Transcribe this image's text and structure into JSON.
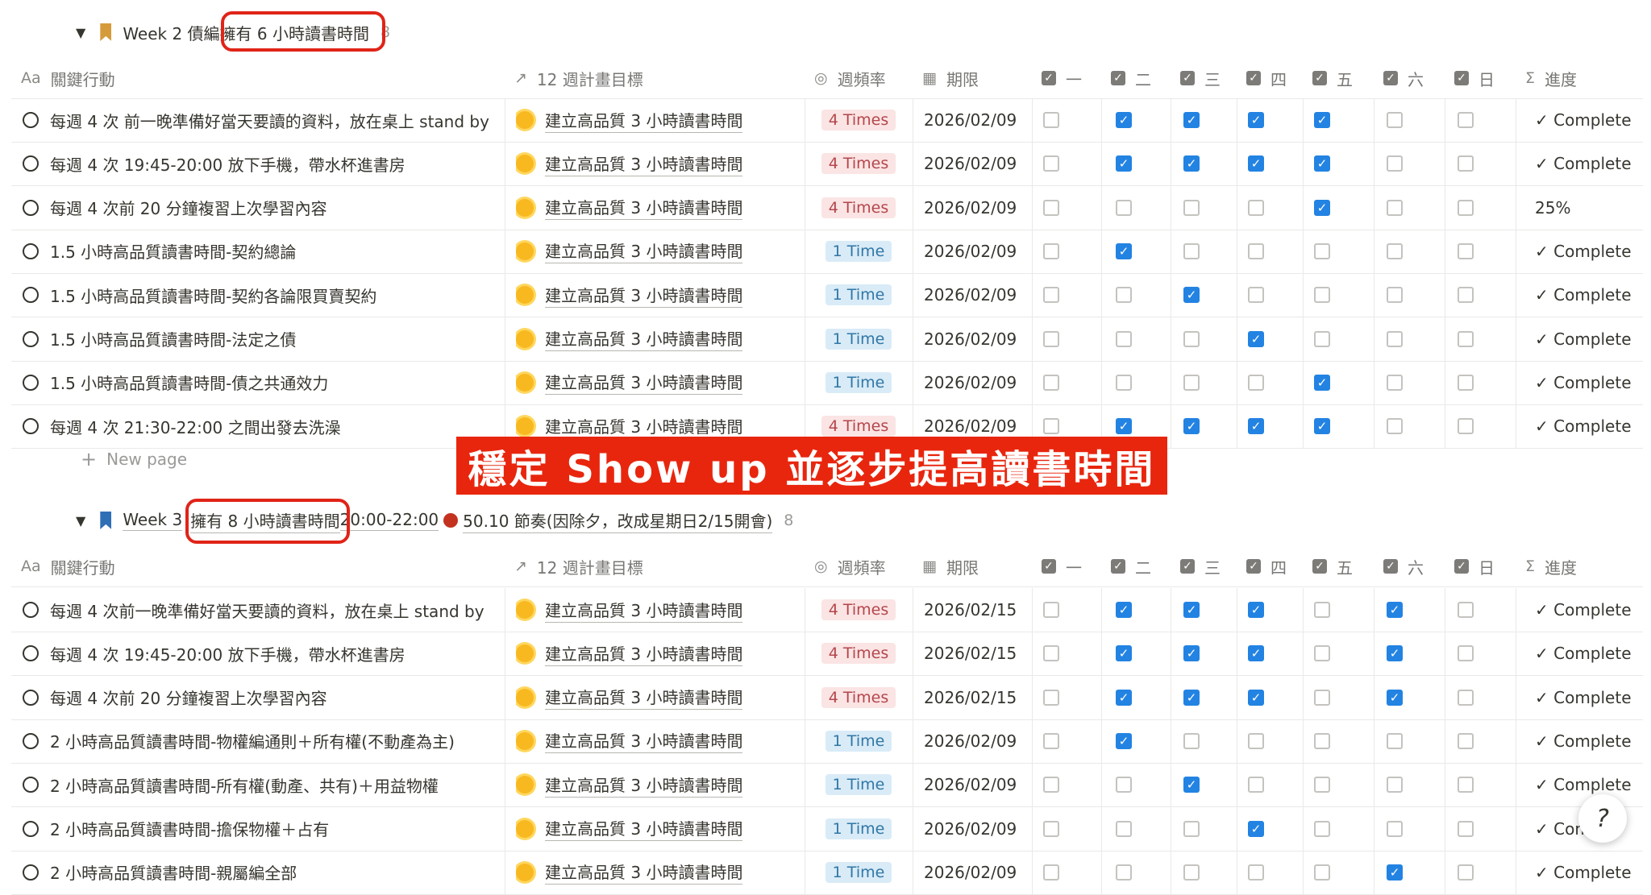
{
  "columns": [
    {
      "key": "name",
      "icon": "Aa",
      "label": "關鍵行動"
    },
    {
      "key": "goal",
      "icon": "↗",
      "label": "12 週計畫目標"
    },
    {
      "key": "freq",
      "icon": "◎",
      "label": "週頻率"
    },
    {
      "key": "date",
      "icon": "calendar-icon",
      "label": "期限"
    },
    {
      "key": "mon",
      "icon": "checkbox-icon",
      "label": "一"
    },
    {
      "key": "tue",
      "icon": "checkbox-icon",
      "label": "二"
    },
    {
      "key": "wed",
      "icon": "checkbox-icon",
      "label": "三"
    },
    {
      "key": "thu",
      "icon": "checkbox-icon",
      "label": "四"
    },
    {
      "key": "fri",
      "icon": "checkbox-icon",
      "label": "五"
    },
    {
      "key": "sat",
      "icon": "checkbox-icon",
      "label": "六"
    },
    {
      "key": "sun",
      "icon": "checkbox-icon",
      "label": "日"
    },
    {
      "key": "prog",
      "icon": "Σ",
      "label": "進度"
    }
  ],
  "groups": [
    {
      "title_prefix": "Week 2 債編",
      "title_highlight": "擁有 6 小時讀書時間",
      "title_suffix": "",
      "count": "8",
      "bookmark_color": "#d59b3a",
      "rows": [
        {
          "name": "每週 4 次 前一晚準備好當天要讀的資料，放在桌上 stand by",
          "goal": "建立高品質 3 小時讀書時間",
          "freq": "4 Times",
          "freq_color": "red",
          "date": "2026/02/09",
          "days": [
            false,
            true,
            true,
            true,
            true,
            false,
            false
          ],
          "progress": "✓ Complete"
        },
        {
          "name": "每週 4 次 19:45-20:00 放下手機，帶水杯進書房",
          "goal": "建立高品質 3 小時讀書時間",
          "freq": "4 Times",
          "freq_color": "red",
          "date": "2026/02/09",
          "days": [
            false,
            true,
            true,
            true,
            true,
            false,
            false
          ],
          "progress": "✓ Complete"
        },
        {
          "name": "每週 4 次前 20 分鐘複習上次學習內容",
          "goal": "建立高品質 3 小時讀書時間",
          "freq": "4 Times",
          "freq_color": "red",
          "date": "2026/02/09",
          "days": [
            false,
            false,
            false,
            false,
            true,
            false,
            false
          ],
          "progress": "25%"
        },
        {
          "name": "1.5 小時高品質讀書時間-契約總論",
          "goal": "建立高品質 3 小時讀書時間",
          "freq": "1 Time",
          "freq_color": "blue",
          "date": "2026/02/09",
          "days": [
            false,
            true,
            false,
            false,
            false,
            false,
            false
          ],
          "progress": "✓ Complete"
        },
        {
          "name": "1.5 小時高品質讀書時間-契約各論限買賣契約",
          "goal": "建立高品質 3 小時讀書時間",
          "freq": "1 Time",
          "freq_color": "blue",
          "date": "2026/02/09",
          "days": [
            false,
            false,
            true,
            false,
            false,
            false,
            false
          ],
          "progress": "✓ Complete"
        },
        {
          "name": "1.5 小時高品質讀書時間-法定之債",
          "goal": "建立高品質 3 小時讀書時間",
          "freq": "1 Time",
          "freq_color": "blue",
          "date": "2026/02/09",
          "days": [
            false,
            false,
            false,
            true,
            false,
            false,
            false
          ],
          "progress": "✓ Complete"
        },
        {
          "name": "1.5 小時高品質讀書時間-債之共通效力",
          "goal": "建立高品質 3 小時讀書時間",
          "freq": "1 Time",
          "freq_color": "blue",
          "date": "2026/02/09",
          "days": [
            false,
            false,
            false,
            false,
            true,
            false,
            false
          ],
          "progress": "✓ Complete"
        },
        {
          "name": "每週 4 次 21:30-22:00 之間出發去洗澡",
          "goal": "建立高品質 3 小時讀書時間",
          "freq": "4 Times",
          "freq_color": "red",
          "date": "2026/02/09",
          "days": [
            false,
            true,
            true,
            true,
            true,
            false,
            false
          ],
          "progress": "✓ Complete"
        }
      ]
    },
    {
      "title_prefix": "Week 3",
      "title_highlight": "擁有 8 小時讀書時間",
      "title_suffix": "20:00-22:00",
      "title_tail": "50.10 節奏(因除夕，改成星期日2/15開會)",
      "count": "8",
      "bookmark_color": "#2f6fb5",
      "rows": [
        {
          "name": "每週 4 次前一晚準備好當天要讀的資料，放在桌上 stand by",
          "goal": "建立高品質 3 小時讀書時間",
          "freq": "4 Times",
          "freq_color": "red",
          "date": "2026/02/15",
          "days": [
            false,
            true,
            true,
            true,
            false,
            true,
            false
          ],
          "progress": "✓ Complete"
        },
        {
          "name": "每週 4 次 19:45-20:00 放下手機，帶水杯進書房",
          "goal": "建立高品質 3 小時讀書時間",
          "freq": "4 Times",
          "freq_color": "red",
          "date": "2026/02/15",
          "days": [
            false,
            true,
            true,
            true,
            false,
            true,
            false
          ],
          "progress": "✓ Complete"
        },
        {
          "name": "每週 4 次前 20 分鐘複習上次學習內容",
          "goal": "建立高品質 3 小時讀書時間",
          "freq": "4 Times",
          "freq_color": "red",
          "date": "2026/02/15",
          "days": [
            false,
            true,
            true,
            true,
            false,
            true,
            false
          ],
          "progress": "✓ Complete"
        },
        {
          "name": "2 小時高品質讀書時間-物權編通則＋所有權(不動產為主)",
          "goal": "建立高品質 3 小時讀書時間",
          "freq": "1 Time",
          "freq_color": "blue",
          "date": "2026/02/09",
          "days": [
            false,
            true,
            false,
            false,
            false,
            false,
            false
          ],
          "progress": "✓ Complete"
        },
        {
          "name": "2 小時高品質讀書時間-所有權(動產、共有)＋用益物權",
          "goal": "建立高品質 3 小時讀書時間",
          "freq": "1 Time",
          "freq_color": "blue",
          "date": "2026/02/09",
          "days": [
            false,
            false,
            true,
            false,
            false,
            false,
            false
          ],
          "progress": "✓ Complete"
        },
        {
          "name": "2 小時高品質讀書時間-擔保物權＋占有",
          "goal": "建立高品質 3 小時讀書時間",
          "freq": "1 Time",
          "freq_color": "blue",
          "date": "2026/02/09",
          "days": [
            false,
            false,
            false,
            true,
            false,
            false,
            false
          ],
          "progress": "✓ Com"
        },
        {
          "name": "2 小時高品質讀書時間-親屬編全部",
          "goal": "建立高品質 3 小時讀書時間",
          "freq": "1 Time",
          "freq_color": "blue",
          "date": "2026/02/09",
          "days": [
            false,
            false,
            false,
            false,
            false,
            true,
            false
          ],
          "progress": "✓ Complete"
        }
      ]
    }
  ],
  "new_page_label": "New page",
  "banner_text": "穩定 Show up 並逐步提高讀書時間",
  "help_glyph": "?"
}
